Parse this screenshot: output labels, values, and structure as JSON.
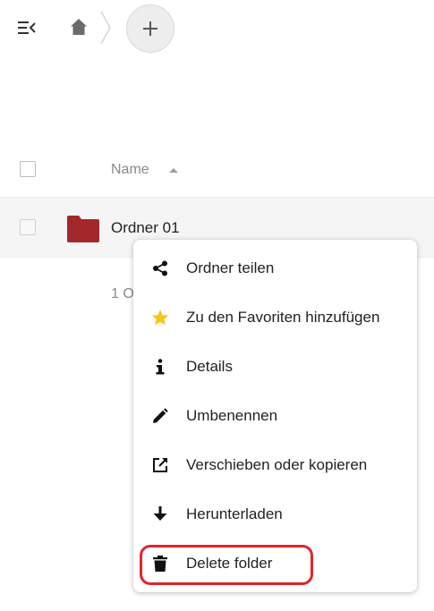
{
  "file_list": {
    "header": {
      "name_column": "Name"
    },
    "rows": [
      {
        "name": "Ordner 01",
        "icon": "folder-icon",
        "icon_color": "#a3282b"
      }
    ],
    "summary_fragment": "1 O"
  },
  "context_menu": {
    "items": [
      {
        "label": "Ordner teilen",
        "icon": "share-icon"
      },
      {
        "label": "Zu den Favoriten hinzufügen",
        "icon": "star-icon",
        "icon_color": "#f5c518"
      },
      {
        "label": "Details",
        "icon": "info-icon"
      },
      {
        "label": "Umbenennen",
        "icon": "pencil-icon"
      },
      {
        "label": "Verschieben oder kopieren",
        "icon": "move-copy-icon"
      },
      {
        "label": "Herunterladen",
        "icon": "download-icon"
      },
      {
        "label": "Delete folder",
        "icon": "trash-icon",
        "highlighted": true,
        "highlight_color": "#e0252b"
      }
    ]
  }
}
